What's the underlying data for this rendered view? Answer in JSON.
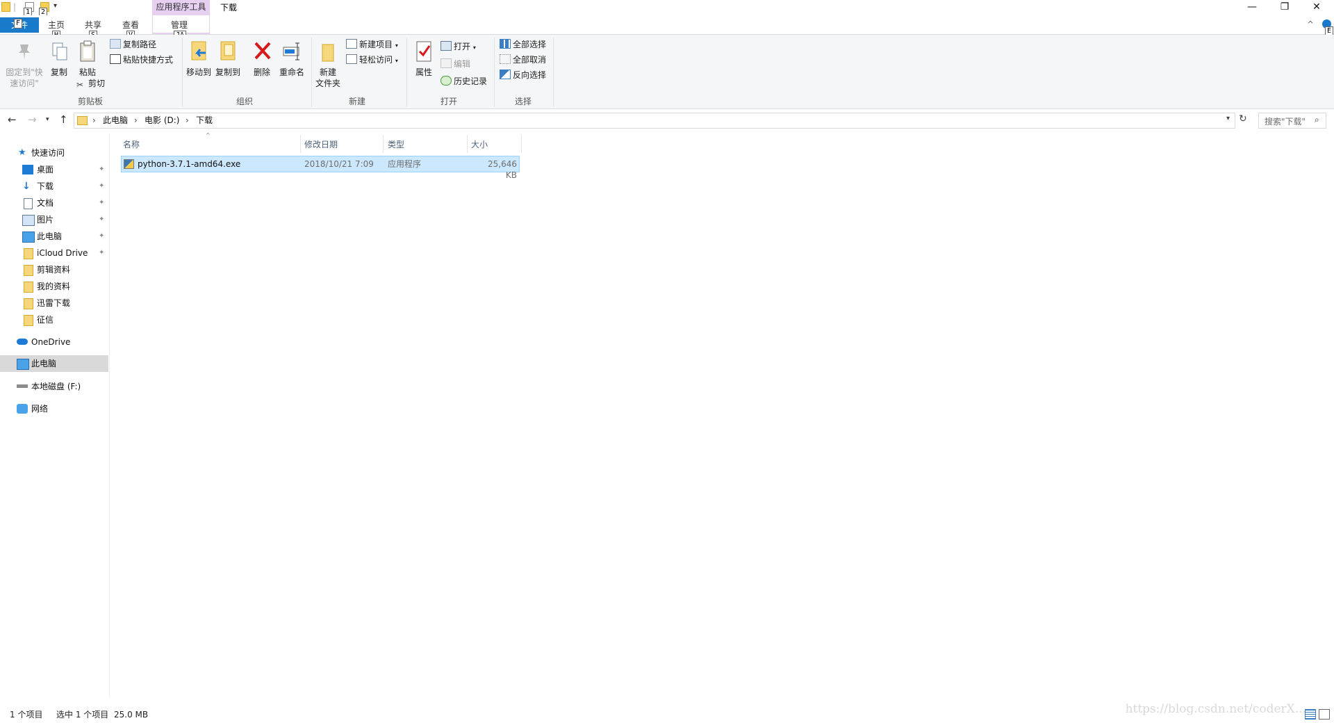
{
  "window": {
    "title": "下载",
    "context_group": "应用程序工具",
    "controls": {
      "minimize": "—",
      "restore": "❐",
      "close": "✕"
    }
  },
  "quick_access_toolbar": {
    "keytips": [
      "1",
      "2"
    ],
    "dropdown": "▾"
  },
  "tabs": {
    "file": "文件",
    "file_keytip": "F",
    "items": [
      {
        "label": "主页",
        "keytip": "H"
      },
      {
        "label": "共享",
        "keytip": "S"
      },
      {
        "label": "查看",
        "keytip": "V"
      },
      {
        "label": "管理",
        "keytip": "JA"
      }
    ],
    "collapse": "^",
    "help_keytip": "E"
  },
  "ribbon": {
    "clipboard": {
      "pin": "固定到\"快\n速访问\"",
      "copy": "复制",
      "paste": "粘贴",
      "copy_path": "复制路径",
      "paste_shortcut": "粘贴快捷方式",
      "cut": "剪切",
      "label": "剪贴板"
    },
    "organize": {
      "move_to": "移动到",
      "copy_to": "复制到",
      "delete": "删除",
      "rename": "重命名",
      "label": "组织"
    },
    "new": {
      "new_folder": "新建\n文件夹",
      "new_item": "新建项目",
      "easy_access": "轻松访问",
      "label": "新建"
    },
    "open": {
      "properties": "属性",
      "open": "打开",
      "edit": "编辑",
      "history": "历史记录",
      "label": "打开"
    },
    "select": {
      "select_all": "全部选择",
      "select_none": "全部取消",
      "invert": "反向选择",
      "label": "选择"
    }
  },
  "address": {
    "crumbs": [
      "此电脑",
      "电影 (D:)",
      "下载"
    ],
    "search_placeholder": "搜索\"下载\""
  },
  "nav": {
    "quick_access": "快速访问",
    "pinned": [
      "桌面",
      "下载",
      "文档",
      "图片",
      "此电脑",
      "iCloud Drive"
    ],
    "folders": [
      "剪辑资料",
      "我的资料",
      "迅雷下载",
      "征信"
    ],
    "onedrive": "OneDrive",
    "this_pc": "此电脑",
    "local_disk": "本地磁盘 (F:)",
    "network": "网络"
  },
  "columns": [
    "名称",
    "修改日期",
    "类型",
    "大小"
  ],
  "files": [
    {
      "name": "python-3.7.1-amd64.exe",
      "modified": "2018/10/21 7:09",
      "type": "应用程序",
      "size": "25,646 KB"
    }
  ],
  "status": {
    "count": "1 个项目",
    "selected": "选中 1 个项目",
    "size": "25.0 MB"
  },
  "watermark": "https://blog.csdn.net/coderX...",
  "colors": {
    "file_tab": "#1979ca",
    "context_group": "#e6cff0",
    "selection_fill": "#cce8ff",
    "selection_border": "#99d1ff",
    "nav_selected": "#d9d9d9"
  }
}
